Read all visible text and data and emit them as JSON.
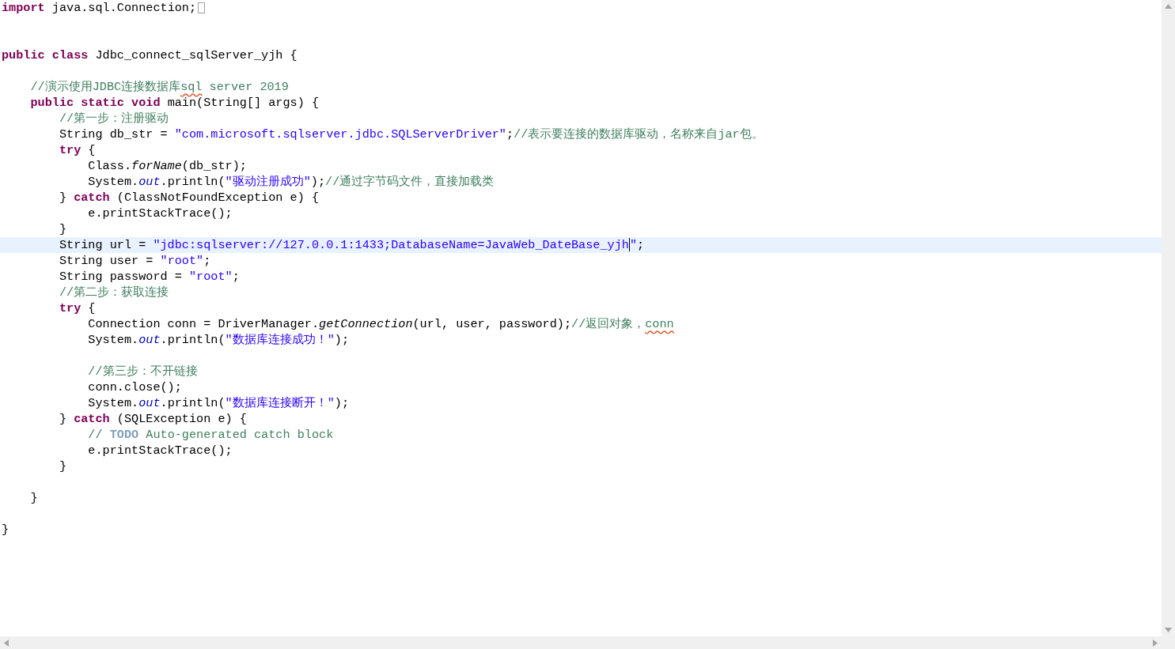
{
  "editor": {
    "lines": [
      {
        "kind": "code",
        "current": false,
        "folded": true,
        "tokens": [
          {
            "kind": "keyword",
            "text": "import"
          },
          {
            "kind": "plain",
            "text": " java.sql.Connection;"
          }
        ]
      },
      {
        "kind": "blank",
        "current": false
      },
      {
        "kind": "blank",
        "current": false
      },
      {
        "kind": "code",
        "current": false,
        "tokens": [
          {
            "kind": "keyword",
            "text": "public class"
          },
          {
            "kind": "plain",
            "text": " Jdbc_connect_sqlServer_yjh {"
          }
        ],
        "children": [
          {
            "kind": "blank",
            "current": false
          },
          {
            "kind": "code",
            "current": false,
            "tokens": [
              {
                "kind": "comment",
                "text": "//演示使用JDBC连接数据库"
              },
              {
                "kind": "misspelled",
                "text": "sql"
              },
              {
                "kind": "comment",
                "text": " server 2019"
              }
            ]
          },
          {
            "kind": "code",
            "current": false,
            "tokens": [
              {
                "kind": "keyword",
                "text": "public static void"
              },
              {
                "kind": "plain",
                "text": " main(String[] args) {"
              }
            ],
            "children": [
              {
                "kind": "code",
                "current": false,
                "tokens": [
                  {
                    "kind": "comment",
                    "text": "//第一步：注册驱动"
                  }
                ]
              },
              {
                "kind": "code",
                "current": false,
                "tokens": [
                  {
                    "kind": "plain",
                    "text": "String db_str = "
                  },
                  {
                    "kind": "string",
                    "text": "\"com.microsoft.sqlserver.jdbc.SQLServerDriver\""
                  },
                  {
                    "kind": "plain",
                    "text": ";"
                  },
                  {
                    "kind": "comment",
                    "text": "//表示要连接的数据库驱动，名称来自jar包。"
                  }
                ]
              },
              {
                "kind": "code",
                "current": false,
                "tokens": [
                  {
                    "kind": "keyword",
                    "text": "try"
                  },
                  {
                    "kind": "plain",
                    "text": " {"
                  }
                ],
                "children": [
                  {
                    "kind": "code",
                    "current": false,
                    "tokens": [
                      {
                        "kind": "plain",
                        "text": "Class."
                      },
                      {
                        "kind": "static-method",
                        "text": "forName"
                      },
                      {
                        "kind": "plain",
                        "text": "(db_str);"
                      }
                    ]
                  },
                  {
                    "kind": "code",
                    "current": false,
                    "tokens": [
                      {
                        "kind": "plain",
                        "text": "System."
                      },
                      {
                        "kind": "field",
                        "text": "out"
                      },
                      {
                        "kind": "plain",
                        "text": ".println("
                      },
                      {
                        "kind": "string",
                        "text": "\"驱动注册成功\""
                      },
                      {
                        "kind": "plain",
                        "text": ");"
                      },
                      {
                        "kind": "comment",
                        "text": "//通过字节码文件，直接加载类"
                      }
                    ]
                  }
                ]
              },
              {
                "kind": "code",
                "current": false,
                "tokens": [
                  {
                    "kind": "plain",
                    "text": "} "
                  },
                  {
                    "kind": "keyword",
                    "text": "catch"
                  },
                  {
                    "kind": "plain",
                    "text": " (ClassNotFoundException e) {"
                  }
                ],
                "children": [
                  {
                    "kind": "code",
                    "current": false,
                    "tokens": [
                      {
                        "kind": "plain",
                        "text": "e.printStackTrace();"
                      }
                    ]
                  }
                ]
              },
              {
                "kind": "code",
                "current": false,
                "tokens": [
                  {
                    "kind": "plain",
                    "text": "}"
                  }
                ]
              },
              {
                "kind": "code",
                "current": true,
                "tokens": [
                  {
                    "kind": "plain",
                    "text": "String url = "
                  },
                  {
                    "kind": "string",
                    "text": "\"jdbc:sqlserver://127.0.0.1:1433;DatabaseName=JavaWeb_DateBase_yjh",
                    "caret_after": true
                  },
                  {
                    "kind": "string",
                    "text": "\""
                  },
                  {
                    "kind": "plain",
                    "text": ";"
                  }
                ]
              },
              {
                "kind": "code",
                "current": false,
                "tokens": [
                  {
                    "kind": "plain",
                    "text": "String user = "
                  },
                  {
                    "kind": "string",
                    "text": "\"root\""
                  },
                  {
                    "kind": "plain",
                    "text": ";"
                  }
                ]
              },
              {
                "kind": "code",
                "current": false,
                "tokens": [
                  {
                    "kind": "plain",
                    "text": "String password = "
                  },
                  {
                    "kind": "string",
                    "text": "\"root\""
                  },
                  {
                    "kind": "plain",
                    "text": ";"
                  }
                ]
              },
              {
                "kind": "code",
                "current": false,
                "tokens": [
                  {
                    "kind": "comment",
                    "text": "//第二步：获取连接"
                  }
                ]
              },
              {
                "kind": "code",
                "current": false,
                "tokens": [
                  {
                    "kind": "keyword",
                    "text": "try"
                  },
                  {
                    "kind": "plain",
                    "text": " {"
                  }
                ],
                "children": [
                  {
                    "kind": "code",
                    "current": false,
                    "tokens": [
                      {
                        "kind": "plain",
                        "text": "Connection conn = DriverManager."
                      },
                      {
                        "kind": "static-method",
                        "text": "getConnection"
                      },
                      {
                        "kind": "plain",
                        "text": "(url, user, password);"
                      },
                      {
                        "kind": "comment",
                        "text": "//返回对象，"
                      },
                      {
                        "kind": "misspelled",
                        "text": "conn"
                      }
                    ]
                  },
                  {
                    "kind": "code",
                    "current": false,
                    "tokens": [
                      {
                        "kind": "plain",
                        "text": "System."
                      },
                      {
                        "kind": "field",
                        "text": "out"
                      },
                      {
                        "kind": "plain",
                        "text": ".println("
                      },
                      {
                        "kind": "string",
                        "text": "\"数据库连接成功！\""
                      },
                      {
                        "kind": "plain",
                        "text": ");"
                      }
                    ]
                  },
                  {
                    "kind": "blank",
                    "current": false
                  },
                  {
                    "kind": "code",
                    "current": false,
                    "tokens": [
                      {
                        "kind": "comment",
                        "text": "//第三步：不开链接"
                      }
                    ]
                  },
                  {
                    "kind": "code",
                    "current": false,
                    "tokens": [
                      {
                        "kind": "plain",
                        "text": "conn.close();"
                      }
                    ]
                  },
                  {
                    "kind": "code",
                    "current": false,
                    "tokens": [
                      {
                        "kind": "plain",
                        "text": "System."
                      },
                      {
                        "kind": "field",
                        "text": "out"
                      },
                      {
                        "kind": "plain",
                        "text": ".println("
                      },
                      {
                        "kind": "string",
                        "text": "\"数据库连接断开！\""
                      },
                      {
                        "kind": "plain",
                        "text": ");"
                      }
                    ]
                  }
                ]
              },
              {
                "kind": "code",
                "current": false,
                "tokens": [
                  {
                    "kind": "plain",
                    "text": "} "
                  },
                  {
                    "kind": "keyword",
                    "text": "catch"
                  },
                  {
                    "kind": "plain",
                    "text": " (SQLException e) {"
                  }
                ],
                "children": [
                  {
                    "kind": "code",
                    "current": false,
                    "tokens": [
                      {
                        "kind": "comment",
                        "text": "// "
                      },
                      {
                        "kind": "task",
                        "text": "TODO"
                      },
                      {
                        "kind": "comment",
                        "text": " Auto-generated catch block"
                      }
                    ]
                  },
                  {
                    "kind": "code",
                    "current": false,
                    "tokens": [
                      {
                        "kind": "plain",
                        "text": "e.printStackTrace();"
                      }
                    ]
                  }
                ]
              },
              {
                "kind": "code",
                "current": false,
                "tokens": [
                  {
                    "kind": "plain",
                    "text": "}"
                  }
                ]
              },
              {
                "kind": "blank",
                "current": false
              }
            ]
          },
          {
            "kind": "code",
            "current": false,
            "tokens": [
              {
                "kind": "plain",
                "text": "}"
              }
            ]
          },
          {
            "kind": "blank",
            "current": false
          }
        ]
      },
      {
        "kind": "code",
        "current": false,
        "tokens": [
          {
            "kind": "plain",
            "text": "}"
          }
        ]
      }
    ]
  }
}
